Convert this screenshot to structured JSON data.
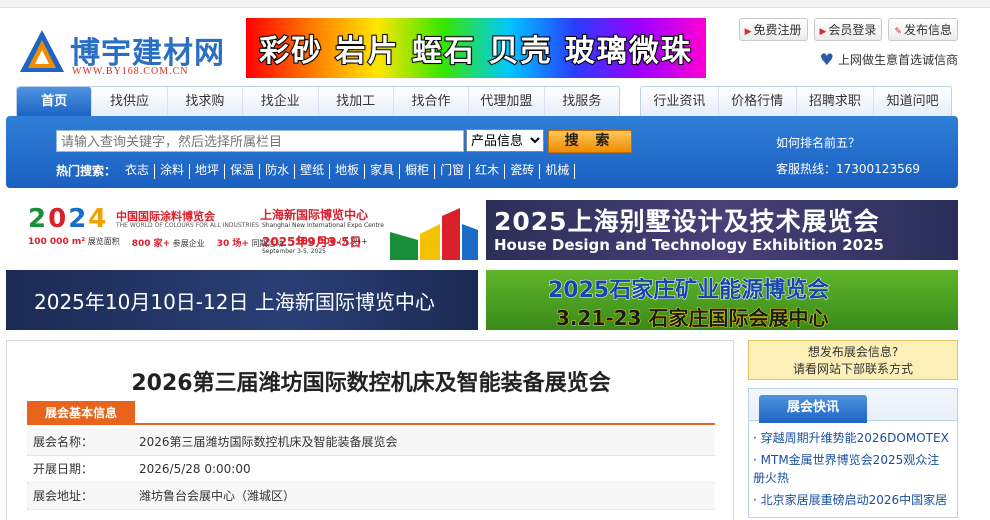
{
  "header": {
    "logo_name": "博宇建材网",
    "logo_site": "WWW.BY168.COM.CN",
    "banner_text": "彩砂 岩片 蛭石 贝壳 玻璃微珠",
    "links": [
      "免费注册",
      "会员登录",
      "发布信息"
    ],
    "slogan": "上网做生意首选诚信商"
  },
  "nav": {
    "left": [
      "首页",
      "找供应",
      "找求购",
      "找企业",
      "找加工",
      "找合作",
      "代理加盟",
      "找服务"
    ],
    "right": [
      "行业资讯",
      "价格行情",
      "招聘求职",
      "知道问吧"
    ]
  },
  "search": {
    "placeholder": "请输入查询关键字，然后选择所属栏目",
    "category": "产品信息",
    "button": "搜 索",
    "hot_label": "热门搜索：",
    "hot": [
      "衣志",
      "涂料",
      "地坪",
      "保温",
      "防水",
      "壁纸",
      "地板",
      "家具",
      "橱柜",
      "门窗",
      "红木",
      "瓷砖",
      "机械"
    ],
    "rank": "如何排名前五？",
    "hotline": "客服热线：17300123569"
  },
  "banners": {
    "b1": {
      "year": [
        "2",
        "0",
        "2",
        "4"
      ],
      "title": "中国国际涂料博览会",
      "subtitle": "THE WORLD OF COLOURS FOR ALL INDUSTRIES",
      "stats": [
        [
          "100 000 m²",
          "展览面积"
        ],
        [
          "800 家+",
          "参展企业"
        ],
        [
          "30 场+",
          "同期活动"
        ],
        [
          "100 000",
          "(人次)+"
        ]
      ],
      "venue": "上海新国际博览中心",
      "venue_en": "Shanghai New International Expo Centre",
      "dates": "2025年9月3-5日",
      "dates_en": "September 3-5, 2025"
    },
    "b2": {
      "cn": "2025上海别墅设计及技术展览会",
      "en": "House Design and Technology Exhibition 2025"
    },
    "b3": {
      "text": "2025年10月10日-12日 上海新国际博览中心"
    },
    "b4": {
      "line1": "2025石家庄矿业能源博览会",
      "line2": "3.21-23 石家庄国际会展中心"
    }
  },
  "main": {
    "title": "2026第三届潍坊国际数控机床及智能装备展览会",
    "section": "展会基本信息",
    "rows": [
      {
        "k": "展会名称：",
        "v": "2026第三届潍坊国际数控机床及智能装备展览会"
      },
      {
        "k": "开展日期：",
        "v": "2026/5/28 0:00:00"
      },
      {
        "k": "展会地址：",
        "v": "潍坊鲁台会展中心（潍城区）"
      }
    ]
  },
  "side": {
    "ad_line1": "想发布展会信息?",
    "ad_line2": "请看网站下部联系方式",
    "news_title": "展会快讯",
    "news": [
      "穿越周期升维势能2026DOMOTEX",
      "MTM金属世界博览会2025观众注册火热",
      "北京家居展重磅启动2026中国家居"
    ]
  },
  "colors": {
    "brand_blue": "#1d64c4",
    "accent_orange": "#e8641c"
  }
}
